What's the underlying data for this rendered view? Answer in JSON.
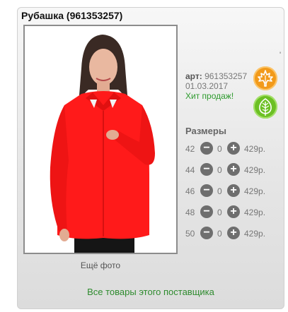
{
  "product": {
    "title": "Рубашка (961353257)",
    "more_photos": "Ещё фото",
    "tick": "'",
    "art_label": "арт:",
    "art_value": "961353257",
    "date": "01.03.2017",
    "hit": "Хит продаж!",
    "badges": [
      {
        "icon": "maple-leaf-icon",
        "color": "#f29a1a"
      },
      {
        "icon": "leaf-icon",
        "color": "#6cc024"
      }
    ]
  },
  "sizes": {
    "title": "Размеры",
    "minus_symbol": "−",
    "plus_symbol": "+",
    "rows": [
      {
        "size": "42",
        "qty": "0",
        "price": "429р."
      },
      {
        "size": "44",
        "qty": "0",
        "price": "429р."
      },
      {
        "size": "46",
        "qty": "0",
        "price": "429р."
      },
      {
        "size": "48",
        "qty": "0",
        "price": "429р."
      },
      {
        "size": "50",
        "qty": "0",
        "price": "429р."
      }
    ]
  },
  "footer": {
    "supplier_link": "Все товары этого поставщика"
  },
  "colors": {
    "shirt": "#ff1a1a",
    "link_green": "#2e8b2e",
    "hit_green": "#2e9b2e"
  }
}
